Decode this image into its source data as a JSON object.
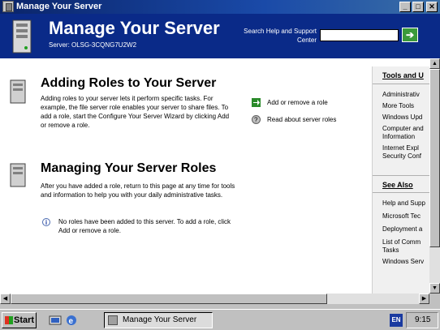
{
  "window": {
    "title": "Manage Your Server",
    "min": "_",
    "max": "□",
    "close": "✕"
  },
  "header": {
    "title": "Manage Your Server",
    "server": "Server: OLSG-3CQNG7U2W2",
    "search_label": "Search Help and Support Center",
    "search_value": "",
    "go": "➔"
  },
  "sections": {
    "adding": {
      "title": "Adding Roles to Your Server",
      "text": "Adding roles to your server lets it perform specific tasks. For example, the file server role enables your server to share files. To add a role, start the Configure Your Server Wizard by clicking Add or remove a role.",
      "actions": [
        {
          "label": "Add or remove a role",
          "icon": "green-arrow-icon"
        },
        {
          "label": "Read about server roles",
          "icon": "help-icon"
        }
      ]
    },
    "managing": {
      "title": "Managing Your Server Roles",
      "text": "After you have added a role, return to this page at any time for tools and information to help you with your daily administrative tasks.",
      "info": "No roles have been added to this server. To add a role, click Add or remove a role."
    }
  },
  "side_panel": {
    "tools_head": "Tools and U",
    "tools_items": [
      "Administrativ",
      "More Tools",
      "Windows Upd",
      "Computer and",
      "Information",
      "Internet Expl",
      "Security Conf"
    ],
    "see_head": "See Also",
    "see_items": [
      "Help and Supp",
      "Microsoft Tec",
      "Deployment a",
      "List of Comm",
      "Tasks",
      "Windows Serv"
    ]
  },
  "taskbar": {
    "start": "Start",
    "task": "Manage Your Server",
    "lang": "EN",
    "clock": "9:15"
  }
}
